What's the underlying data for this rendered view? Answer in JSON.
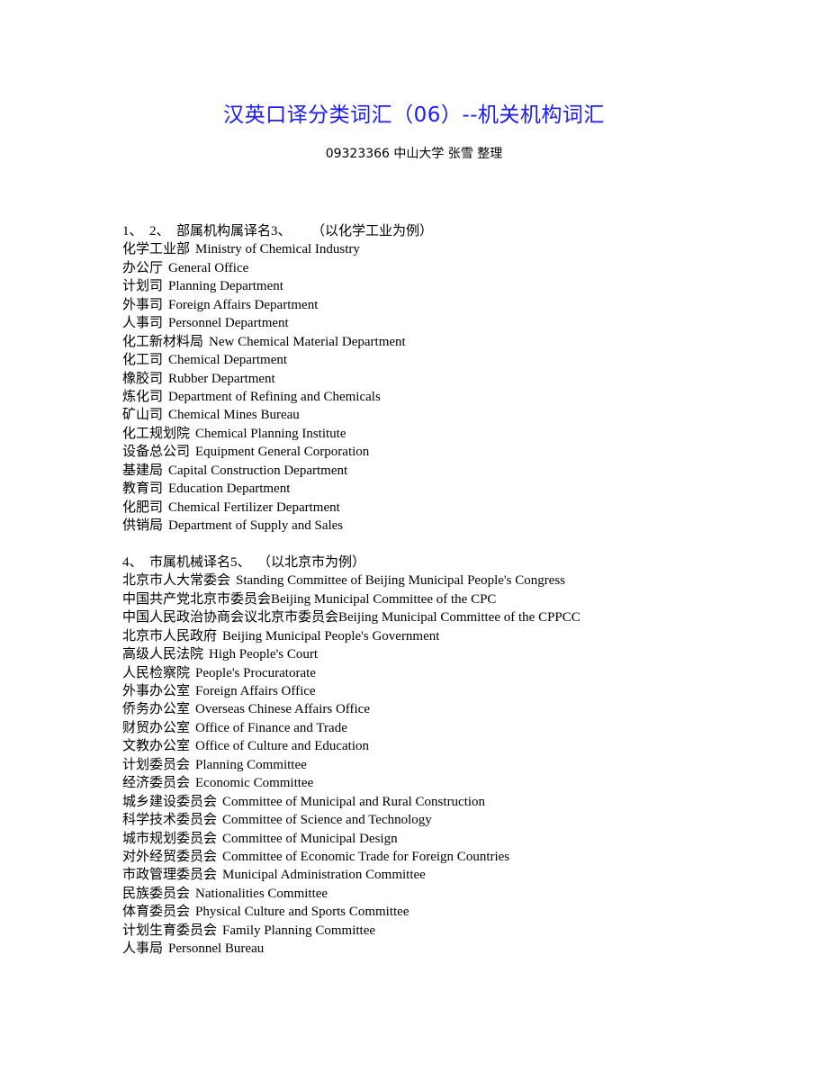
{
  "document": {
    "title": "汉英口译分类词汇（06）--机关机构词汇",
    "subtitle": "09323366  中山大学  张雪  整理",
    "sections": [
      {
        "heading": "1、  2、  部属机构属译名3、      （以化学工业为例）",
        "entries": [
          {
            "zh": "化学工业部",
            "en": "Ministry of Chemical Industry"
          },
          {
            "zh": "办公厅",
            "en": "General Office"
          },
          {
            "zh": "计划司",
            "en": "Planning Department"
          },
          {
            "zh": "外事司",
            "en": "Foreign Affairs Department"
          },
          {
            "zh": "人事司",
            "en": "Personnel Department"
          },
          {
            "zh": "化工新材料局",
            "en": "New Chemical Material Department"
          },
          {
            "zh": "化工司",
            "en": "Chemical Department"
          },
          {
            "zh": "橡胶司",
            "en": "Rubber Department"
          },
          {
            "zh": "炼化司",
            "en": "Department of Refining and Chemicals"
          },
          {
            "zh": "矿山司",
            "en": "Chemical Mines Bureau"
          },
          {
            "zh": "化工规划院",
            "en": "Chemical Planning Institute"
          },
          {
            "zh": "设备总公司",
            "en": "Equipment General Corporation"
          },
          {
            "zh": "基建局",
            "en": "Capital Construction Department"
          },
          {
            "zh": "教育司",
            "en": "Education Department"
          },
          {
            "zh": "化肥司",
            "en": "Chemical Fertilizer Department"
          },
          {
            "zh": "供销局",
            "en": "Department of Supply and Sales"
          }
        ]
      },
      {
        "heading": "4、  市属机械译名5、  （以北京市为例）",
        "entries": [
          {
            "zh": "北京市人大常委会",
            "en": "Standing Committee of Beijing Municipal People's Congress"
          },
          {
            "zh": "中国共产党北京市委员会",
            "en": "Beijing Municipal Committee of the CPC",
            "tight": true
          },
          {
            "zh": "中国人民政治协商会议北京市委员会",
            "en": "Beijing Municipal Committee of the CPPCC",
            "tight": true
          },
          {
            "zh": "北京市人民政府",
            "en": "Beijing Municipal People's Government"
          },
          {
            "zh": "高级人民法院",
            "en": "High People's Court"
          },
          {
            "zh": "人民检察院",
            "en": "People's Procuratorate"
          },
          {
            "zh": "外事办公室",
            "en": "Foreign Affairs Office"
          },
          {
            "zh": "侨务办公室",
            "en": "Overseas Chinese Affairs Office"
          },
          {
            "zh": "财贸办公室",
            "en": "Office of Finance and Trade"
          },
          {
            "zh": "文教办公室",
            "en": "Office of Culture and Education"
          },
          {
            "zh": "计划委员会",
            "en": "Planning Committee"
          },
          {
            "zh": "经济委员会",
            "en": "Economic Committee"
          },
          {
            "zh": "城乡建设委员会",
            "en": "Committee of Municipal and Rural Construction"
          },
          {
            "zh": "科学技术委员会",
            "en": "Committee of Science and Technology"
          },
          {
            "zh": "城市规划委员会",
            "en": "Committee of Municipal Design"
          },
          {
            "zh": "对外经贸委员会",
            "en": "Committee of Economic Trade for Foreign Countries"
          },
          {
            "zh": "市政管理委员会",
            "en": "Municipal Administration Committee"
          },
          {
            "zh": "民族委员会",
            "en": "Nationalities Committee"
          },
          {
            "zh": "体育委员会",
            "en": "Physical Culture and Sports Committee"
          },
          {
            "zh": "计划生育委员会",
            "en": "Family Planning Committee"
          },
          {
            "zh": "人事局",
            "en": "Personnel Bureau"
          }
        ]
      }
    ]
  },
  "colors": {
    "title": "#1a1aff",
    "text": "#000000"
  }
}
